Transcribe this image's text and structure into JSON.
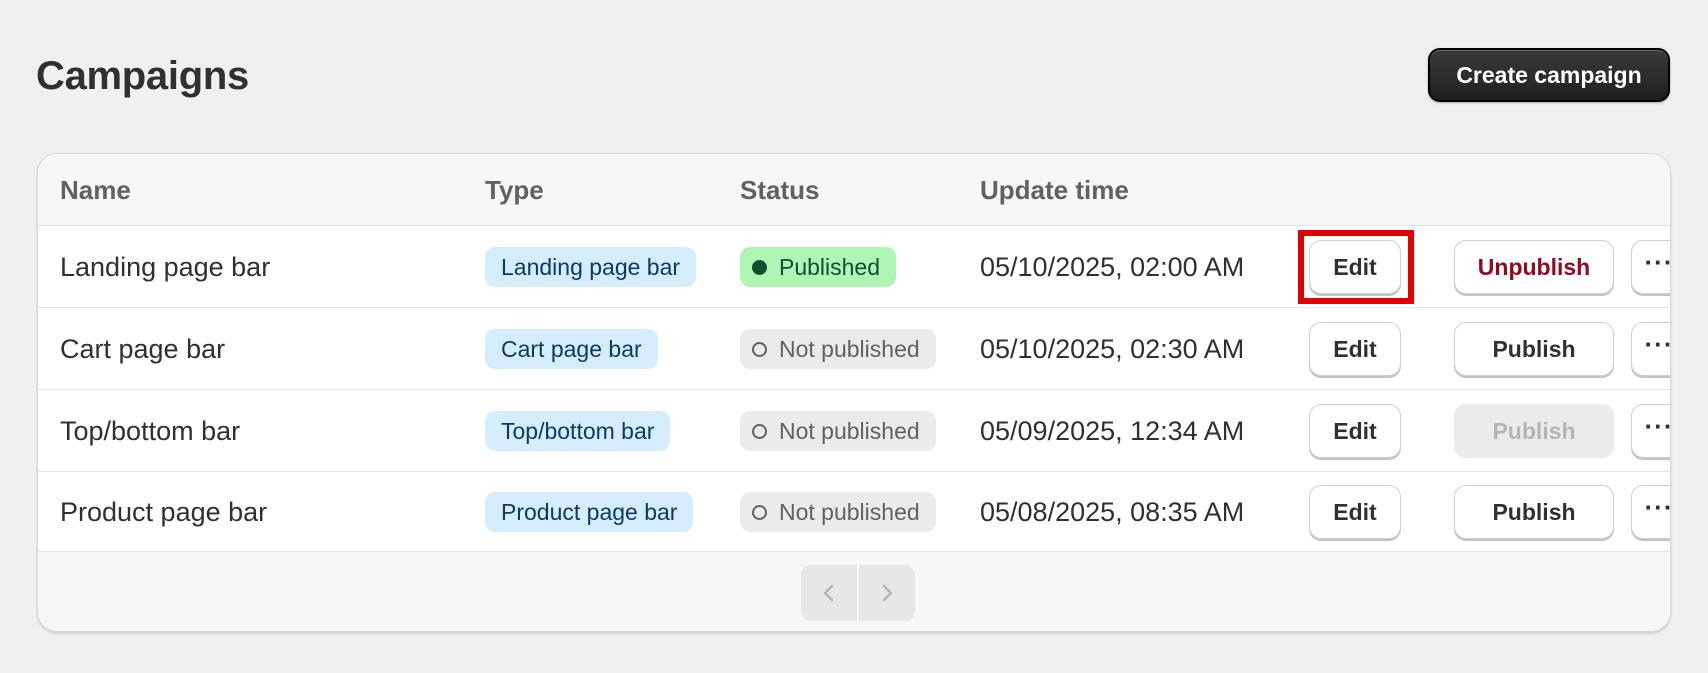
{
  "header": {
    "title": "Campaigns",
    "create_label": "Create campaign"
  },
  "table": {
    "columns": [
      "Name",
      "Type",
      "Status",
      "Update time"
    ],
    "rows": [
      {
        "name": "Landing page bar",
        "type": "Landing page bar",
        "status": "Published",
        "updated": "05/10/2025, 02:00 AM",
        "edit_label": "Edit",
        "action_label": "Unpublish",
        "action_state": "danger"
      },
      {
        "name": "Cart page bar",
        "type": "Cart page bar",
        "status": "Not published",
        "updated": "05/10/2025, 02:30 AM",
        "edit_label": "Edit",
        "action_label": "Publish",
        "action_state": "normal"
      },
      {
        "name": "Top/bottom bar",
        "type": "Top/bottom bar",
        "status": "Not published",
        "updated": "05/09/2025, 12:34 AM",
        "edit_label": "Edit",
        "action_label": "Publish",
        "action_state": "disabled"
      },
      {
        "name": "Product page bar",
        "type": "Product page bar",
        "status": "Not published",
        "updated": "05/08/2025, 08:35 AM",
        "edit_label": "Edit",
        "action_label": "Publish",
        "action_state": "normal"
      }
    ],
    "more_label": "···"
  },
  "pagination": {
    "prev_icon": "chevron-left-icon",
    "next_icon": "chevron-right-icon"
  },
  "colors": {
    "highlight": "#e00000",
    "published_badge": "#aff5b4",
    "type_badge": "#d6ecff",
    "danger_text": "#8e0b21"
  }
}
